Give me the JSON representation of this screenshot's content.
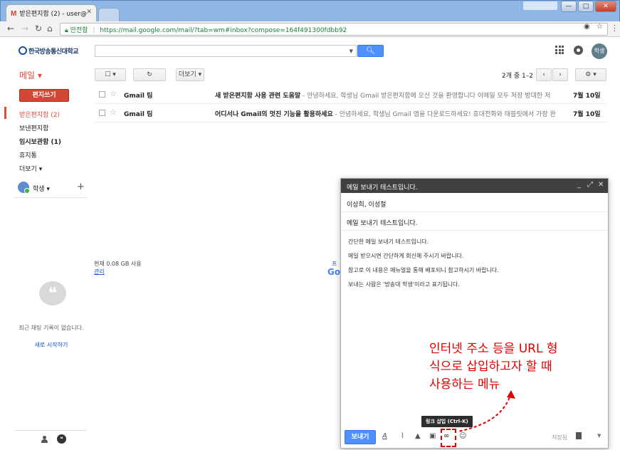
{
  "browser": {
    "tab_title": "받은편지함 (2) - user@",
    "tab_icon": "M",
    "secure_label": "안전함",
    "url": "https://mail.google.com/mail/?tab=wm#inbox?compose=164f491300fdbb92",
    "user_chip": "",
    "window_buttons": [
      "—",
      "□",
      "✕"
    ]
  },
  "header": {
    "logo_text": "한국방송통신대학교",
    "search_placeholder": "",
    "avatar_label": "학생"
  },
  "actions": {
    "mail_label": "메일 ▾",
    "more_label": "더보기 ▾",
    "pager_text": "2개 중 1–2",
    "prev": "‹",
    "next": "›"
  },
  "sidebar": {
    "compose_label": "편지쓰기",
    "items": [
      {
        "label": "받은편지함 (2)"
      },
      {
        "label": "보낸편지함"
      },
      {
        "label": "임시보관함 (1)"
      },
      {
        "label": "휴지통"
      },
      {
        "label": "더보기 ▾"
      }
    ],
    "hangout_name": "학생 ▾",
    "no_chat": "최근 채팅 기록이 없습니다.",
    "start_chat": "새로 시작하기"
  },
  "inbox": {
    "rows": [
      {
        "sender": "Gmail 팀",
        "subject": "새 받은편지함 사용 관련 도움말",
        "snippet": " - 안녕하세요, 학생님 Gmail 받은편지함에 오신 것을 환영합니다 이메일 모두 저장 방대한 저",
        "date": "7월 10일"
      },
      {
        "sender": "Gmail 팀",
        "subject": "어디서나 Gmail의 멋진 기능을 활용하세요",
        "snippet": " - 안녕하세요, 학생님 Gmail 앱을 다운로드하세요! 휴대전화와 태블릿에서 가장 완",
        "date": "7월 10일"
      }
    ],
    "usage": "현재 0.08 GB 사용",
    "manage": "관리",
    "behind_link": "프",
    "behind_logo": "Go"
  },
  "compose": {
    "title": "메일 보내기 테스트입니다.",
    "recipients": "이상희, 이성철",
    "subject": "메일 보내기 테스트입니다.",
    "body": [
      "간단한 메일 보내기 테스트입니다.",
      "메일 받으시면 간단하게 회신해 주시기 바랍니다.",
      "참고로 이 내용은 메뉴얼을 통해 배포되니 참고하시기 바랍니다.",
      "보내는 사람은 '방송대 학생'이라고 표기됩니다."
    ],
    "send_label": "보내기",
    "tooltip": "링크 삽입 (Ctrl-K)",
    "saved_label": "저장됨"
  },
  "annotation": {
    "lines": [
      "인터넷 주소 등을 URL  형",
      "식으로 삽입하고자 할  때",
      "사용하는 메뉴"
    ],
    "color": "#e00000"
  }
}
